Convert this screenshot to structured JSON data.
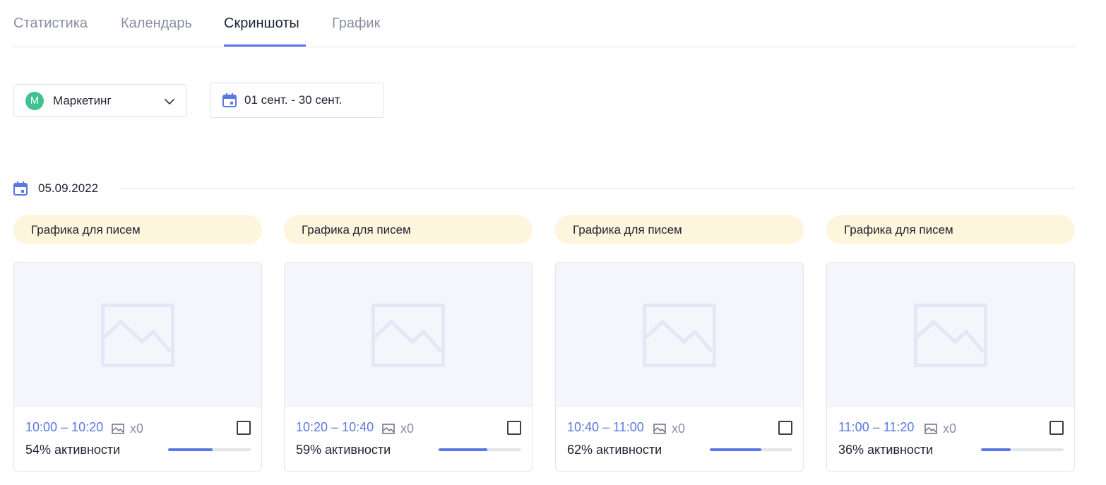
{
  "tabs": [
    {
      "label": "Статистика",
      "active": false
    },
    {
      "label": "Календарь",
      "active": false
    },
    {
      "label": "Скриншоты",
      "active": true
    },
    {
      "label": "График",
      "active": false
    }
  ],
  "filters": {
    "project": {
      "avatar_letter": "M",
      "label": "Маркетинг"
    },
    "date_range": "01 сент. - 30 сент."
  },
  "day": {
    "date": "05.09.2022"
  },
  "cards": [
    {
      "tag": "Графика для писем",
      "time": "10:00 – 10:20",
      "shots": "x0",
      "activity": "54% активности",
      "activity_value": 0.54
    },
    {
      "tag": "Графика для писем",
      "time": "10:20 – 10:40",
      "shots": "x0",
      "activity": "59% активности",
      "activity_value": 0.59
    },
    {
      "tag": "Графика для писем",
      "time": "10:40 – 11:00",
      "shots": "x0",
      "activity": "62% активности",
      "activity_value": 0.62
    },
    {
      "tag": "Графика для писем",
      "time": "11:00 – 11:20",
      "shots": "x0",
      "activity": "36% активности",
      "activity_value": 0.36
    }
  ],
  "colors": {
    "accent": "#5a78e4",
    "avatar": "#3ec28f",
    "tag_bg": "#fdf5dc"
  }
}
